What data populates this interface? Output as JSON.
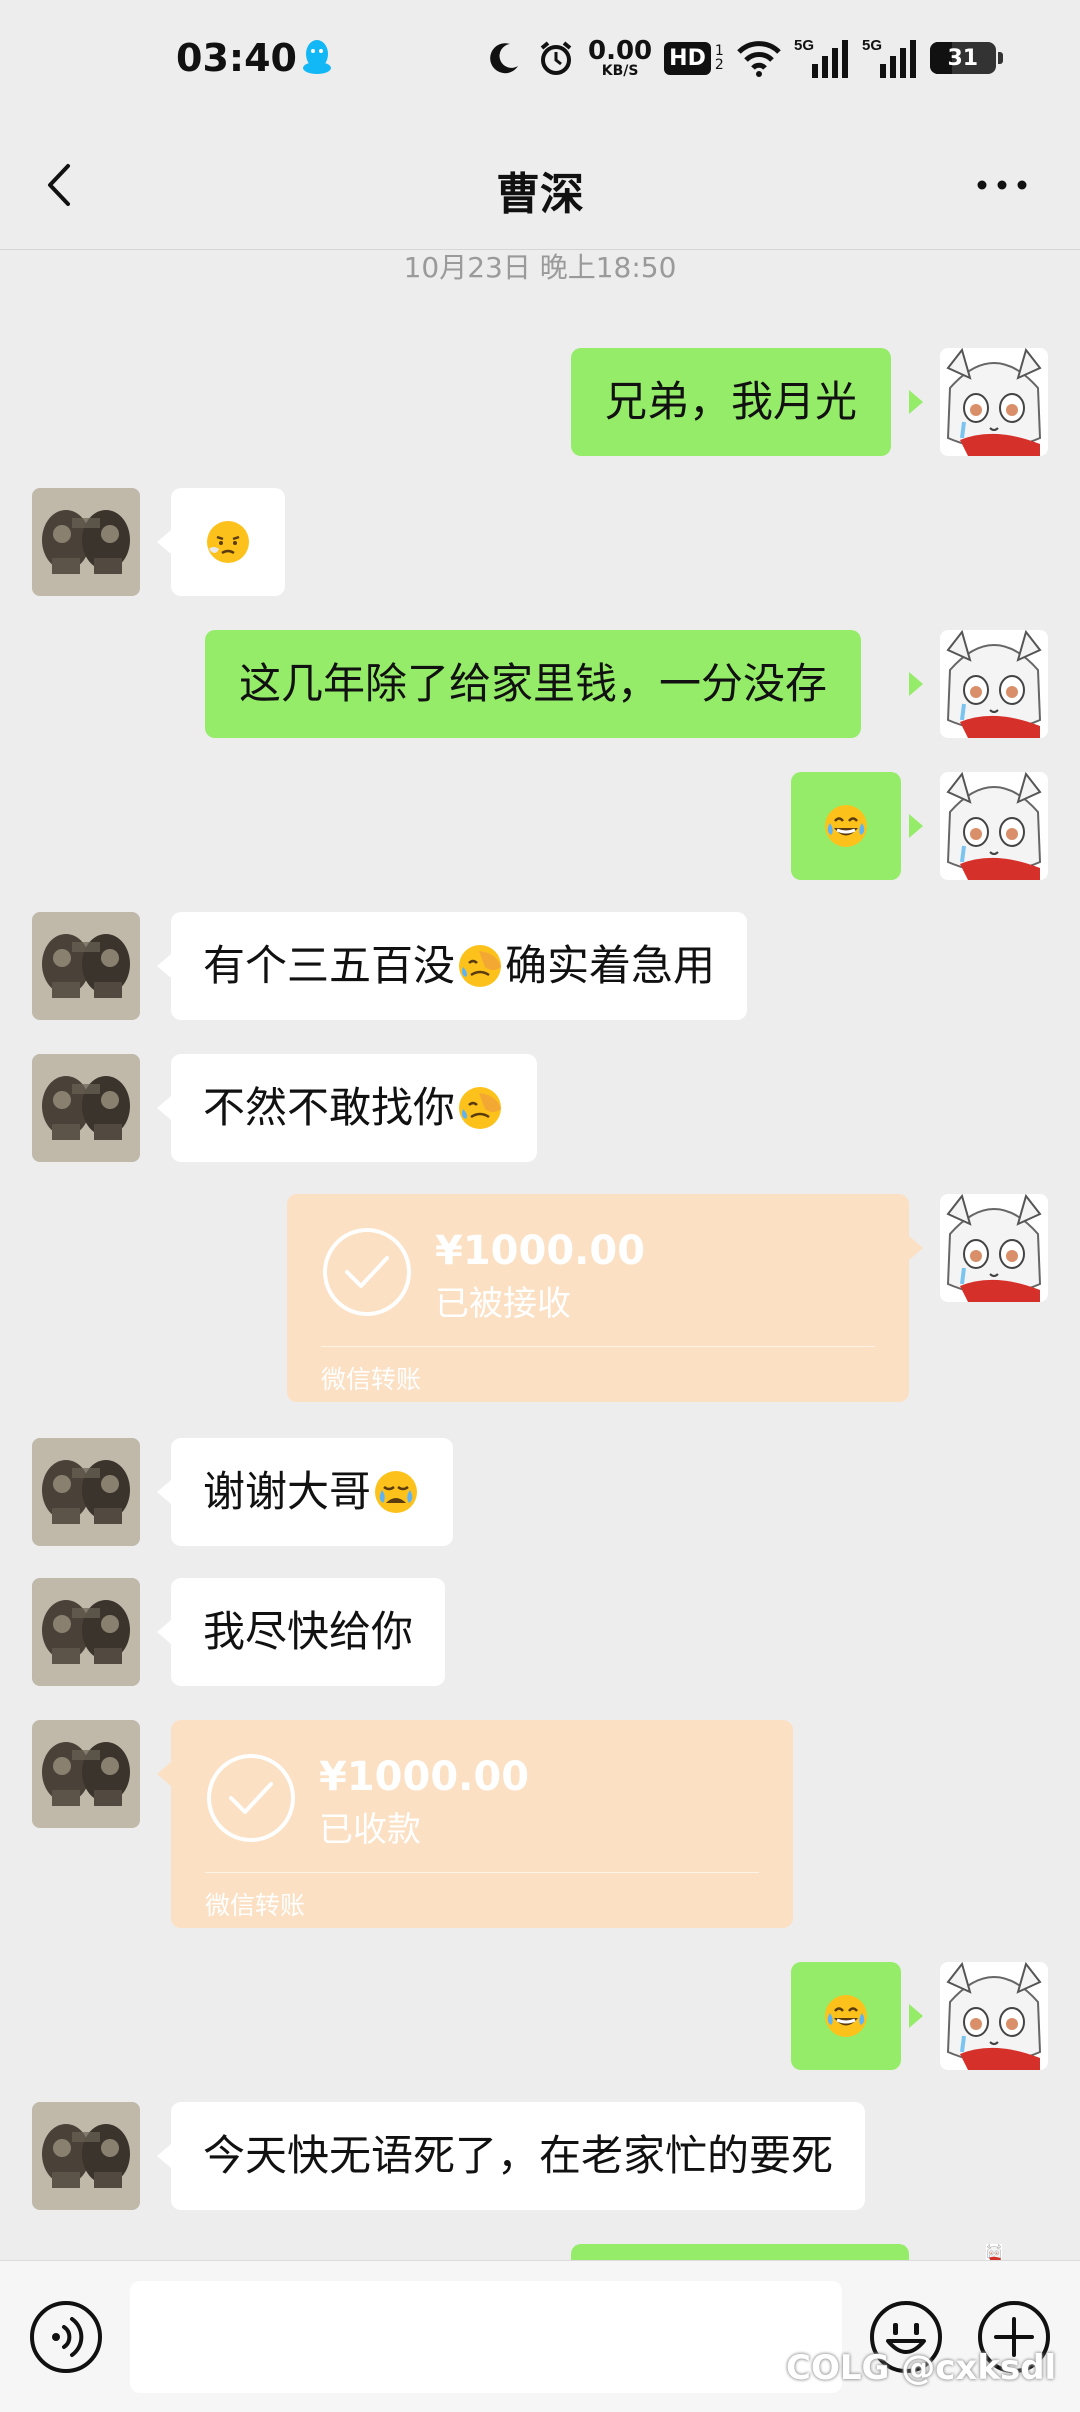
{
  "status_bar": {
    "time": "03:40",
    "net_speed_value": "0.00",
    "net_speed_unit": "KB/S",
    "hd_label": "HD",
    "hd_sub_top": "1",
    "hd_sub_bottom": "2",
    "signal_label_1": "5G",
    "signal_label_2": "5G",
    "battery_level": "31"
  },
  "header": {
    "title": "曹深"
  },
  "chat": {
    "timestamp": "10月23日 晚上18:50",
    "messages": [
      {
        "side": "right",
        "type": "text",
        "text": "兄弟，我月光"
      },
      {
        "side": "left",
        "type": "emoji",
        "emoji": "sad-face-emoji"
      },
      {
        "side": "right",
        "type": "text",
        "text": "这几年除了给家里钱，一分没存"
      },
      {
        "side": "right",
        "type": "emoji",
        "emoji": "tears-of-joy-emoji"
      },
      {
        "side": "left",
        "type": "text",
        "text_before": "有个三五百没",
        "emoji": "facepalm-emoji",
        "text_after": "确实着急用"
      },
      {
        "side": "left",
        "type": "text",
        "text_before": "不然不敢找你",
        "emoji": "facepalm-emoji",
        "text_after": ""
      },
      {
        "side": "right",
        "type": "transfer",
        "amount": "¥1000.00",
        "status": "已被接收",
        "label": "微信转账"
      },
      {
        "side": "left",
        "type": "text",
        "text_before": "谢谢大哥",
        "emoji": "crying-face-emoji",
        "text_after": ""
      },
      {
        "side": "left",
        "type": "text",
        "text": "我尽快给你"
      },
      {
        "side": "left",
        "type": "transfer",
        "amount": "¥1000.00",
        "status": "已收款",
        "label": "微信转账"
      },
      {
        "side": "right",
        "type": "emoji",
        "emoji": "tears-of-joy-emoji"
      },
      {
        "side": "left",
        "type": "text",
        "text": "今天快无语死了，在老家忙的要死"
      }
    ]
  },
  "watermark": "COLG @cxksdl",
  "colors": {
    "bubble_green": "#95ec69",
    "bubble_white": "#ffffff",
    "transfer_bg": "#fbe0c3",
    "background": "#ededed"
  }
}
